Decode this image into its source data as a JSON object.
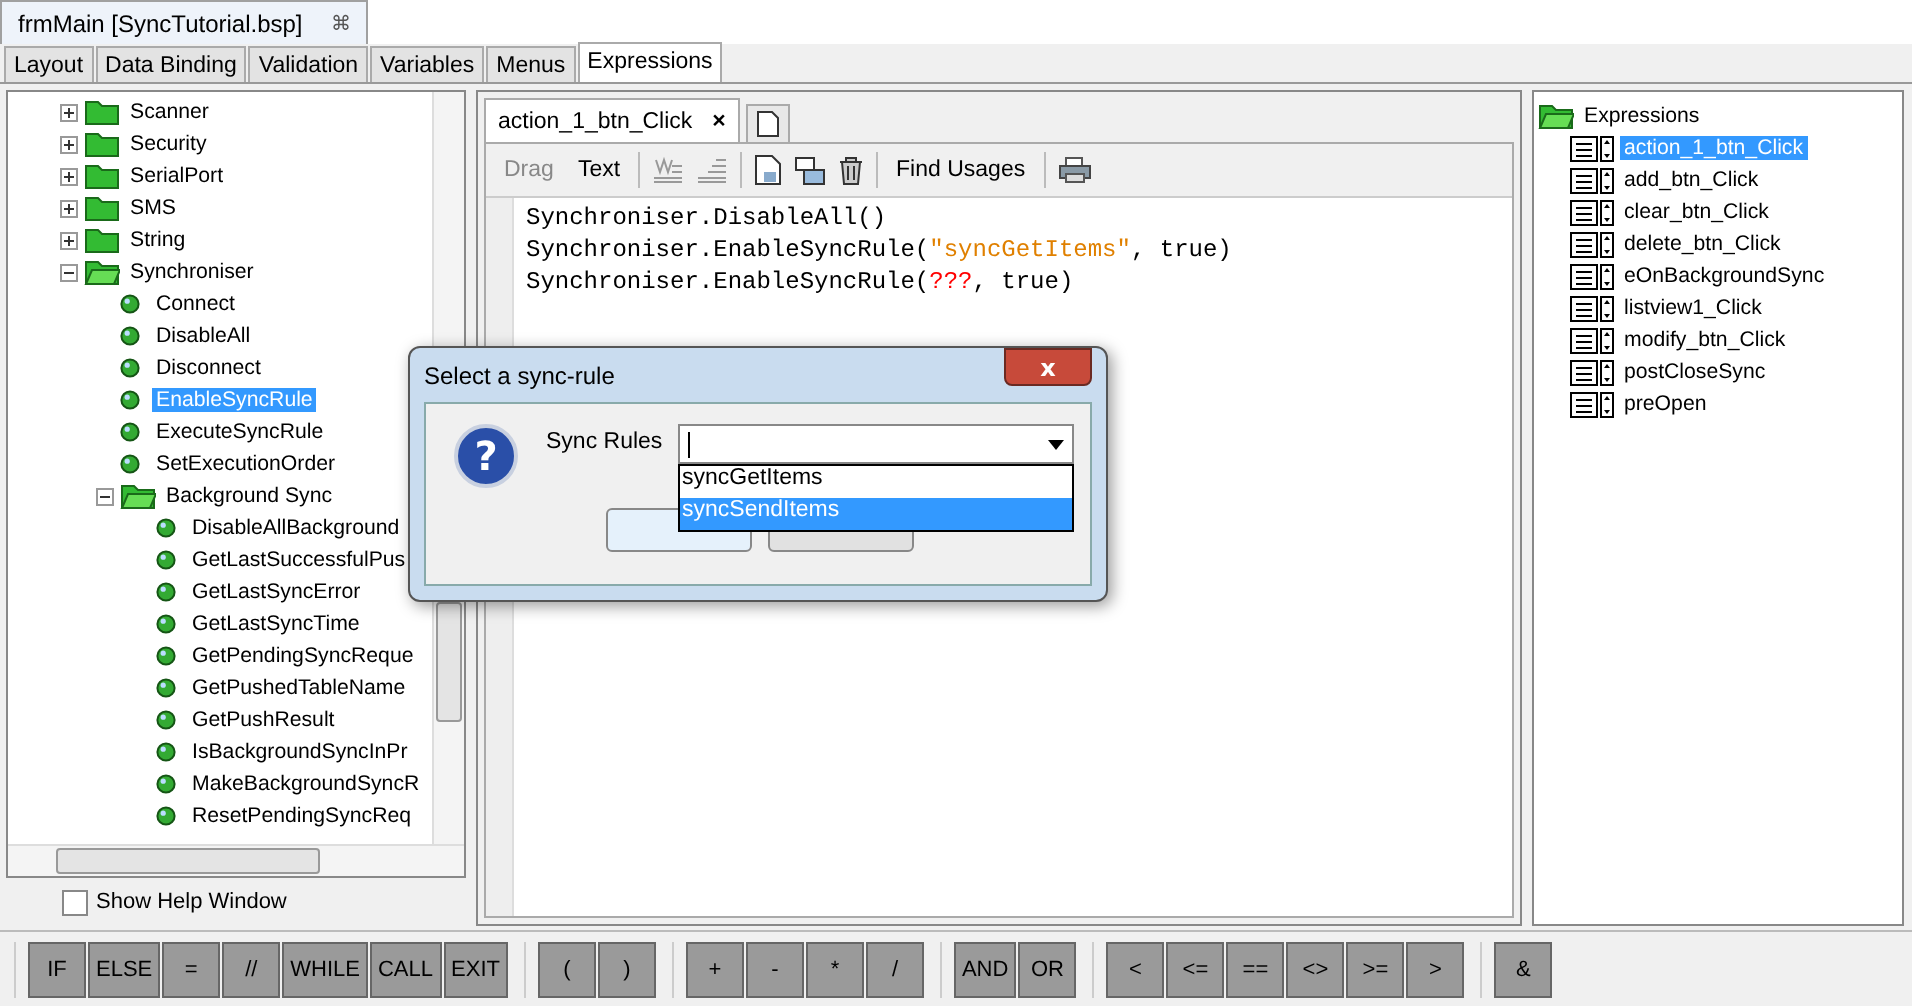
{
  "document_tab": {
    "title": "frmMain [SyncTutorial.bsp]",
    "close": "⌘"
  },
  "tabs": [
    {
      "label": "Layout",
      "selected": false
    },
    {
      "label": "Data Binding",
      "selected": false
    },
    {
      "label": "Validation",
      "selected": false
    },
    {
      "label": "Variables",
      "selected": false
    },
    {
      "label": "Menus",
      "selected": false
    },
    {
      "label": "Expressions",
      "selected": true
    }
  ],
  "function_tree": [
    {
      "label": "Scanner",
      "kind": "folder",
      "expanded": false,
      "selected": false
    },
    {
      "label": "Security",
      "kind": "folder",
      "expanded": false,
      "selected": false
    },
    {
      "label": "SerialPort",
      "kind": "folder",
      "expanded": false,
      "selected": false
    },
    {
      "label": "SMS",
      "kind": "folder",
      "expanded": false,
      "selected": false
    },
    {
      "label": "String",
      "kind": "folder",
      "expanded": false,
      "selected": false
    },
    {
      "label": "Synchroniser",
      "kind": "folder",
      "expanded": true,
      "selected": false,
      "children": [
        {
          "label": "Connect",
          "kind": "function",
          "selected": false
        },
        {
          "label": "DisableAll",
          "kind": "function",
          "selected": false
        },
        {
          "label": "Disconnect",
          "kind": "function",
          "selected": false
        },
        {
          "label": "EnableSyncRule",
          "kind": "function",
          "selected": true
        },
        {
          "label": "ExecuteSyncRule",
          "kind": "function",
          "selected": false
        },
        {
          "label": "SetExecutionOrder",
          "kind": "function",
          "selected": false
        },
        {
          "label": "Background Sync",
          "kind": "folder",
          "expanded": true,
          "selected": false,
          "children": [
            {
              "label": "DisableAllBackground",
              "kind": "function",
              "selected": false
            },
            {
              "label": "GetLastSuccessfulPus",
              "kind": "function",
              "selected": false
            },
            {
              "label": "GetLastSyncError",
              "kind": "function",
              "selected": false
            },
            {
              "label": "GetLastSyncTime",
              "kind": "function",
              "selected": false
            },
            {
              "label": "GetPendingSyncReque",
              "kind": "function",
              "selected": false
            },
            {
              "label": "GetPushedTableName",
              "kind": "function",
              "selected": false
            },
            {
              "label": "GetPushResult",
              "kind": "function",
              "selected": false
            },
            {
              "label": "IsBackgroundSyncInPr",
              "kind": "function",
              "selected": false
            },
            {
              "label": "MakeBackgroundSyncR",
              "kind": "function",
              "selected": false
            },
            {
              "label": "ResetPendingSyncReq",
              "kind": "function",
              "selected": false
            }
          ]
        }
      ]
    }
  ],
  "show_help_window": {
    "label": "Show Help Window",
    "checked": false
  },
  "editor": {
    "tab": {
      "title": "action_1_btn_Click",
      "close": "×"
    },
    "toolbar": [
      {
        "kind": "text",
        "label": "Drag",
        "disabled": true
      },
      {
        "kind": "text",
        "label": "Text",
        "disabled": false
      },
      {
        "kind": "sep"
      },
      {
        "kind": "format"
      },
      {
        "kind": "align"
      },
      {
        "kind": "sep"
      },
      {
        "kind": "page"
      },
      {
        "kind": "windows"
      },
      {
        "kind": "trash"
      },
      {
        "kind": "sep"
      },
      {
        "kind": "text",
        "label": "Find Usages",
        "disabled": false
      },
      {
        "kind": "sep"
      },
      {
        "kind": "printer"
      }
    ],
    "code_lines": [
      [
        {
          "kind": "plain",
          "text": "Synchroniser.DisableAll()"
        }
      ],
      [
        {
          "kind": "plain",
          "text": "Synchroniser.EnableSyncRule("
        },
        {
          "kind": "string",
          "text": "\"syncGetItems\""
        },
        {
          "kind": "plain",
          "text": ", true)"
        }
      ],
      [
        {
          "kind": "plain",
          "text": "Synchroniser.EnableSyncRule("
        },
        {
          "kind": "error",
          "text": "???"
        },
        {
          "kind": "plain",
          "text": ", true)"
        }
      ]
    ]
  },
  "expressions": {
    "label": "Expressions",
    "items": [
      {
        "label": "action_1_btn_Click",
        "selected": true
      },
      {
        "label": "add_btn_Click",
        "selected": false
      },
      {
        "label": "clear_btn_Click",
        "selected": false
      },
      {
        "label": "delete_btn_Click",
        "selected": false
      },
      {
        "label": "eOnBackgroundSync",
        "selected": false
      },
      {
        "label": "listview1_Click",
        "selected": false
      },
      {
        "label": "modify_btn_Click",
        "selected": false
      },
      {
        "label": "postCloseSync",
        "selected": false
      },
      {
        "label": "preOpen",
        "selected": false
      }
    ]
  },
  "operator_groups": [
    [
      "IF",
      "ELSE",
      "=",
      "//",
      "WHILE",
      "CALL",
      "EXIT"
    ],
    [
      "(",
      ")"
    ],
    [
      "+",
      "-",
      "*",
      "/"
    ],
    [
      "AND",
      "OR"
    ],
    [
      "<",
      "<=",
      "==",
      "<>",
      ">=",
      ">"
    ],
    [
      "&"
    ]
  ],
  "dialog": {
    "title": "Select a sync-rule",
    "close": "x",
    "icon": "?",
    "field_label": "Sync Rules",
    "options": [
      {
        "label": "syncGetItems",
        "selected": false
      },
      {
        "label": "syncSendItems",
        "selected": true
      }
    ]
  }
}
